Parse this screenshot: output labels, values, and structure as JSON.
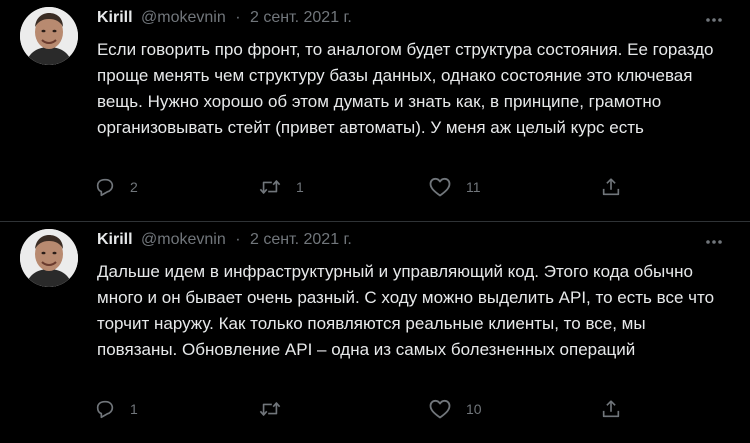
{
  "tweets": [
    {
      "author": "Kirill",
      "handle": "@mokevnin",
      "separator": "·",
      "date": "2 сент. 2021 г.",
      "text": "Если говорить про фронт, то аналогом будет структура состояния. Ее гораздо проще менять чем структуру базы данных, однако состояние это ключевая вещь. Нужно хорошо об этом думать и знать как, в принципе, грамотно организовывать стейт (привет автоматы). У меня аж целый курс есть",
      "reply_count": "2",
      "retweet_count": "1",
      "like_count": "11"
    },
    {
      "author": "Kirill",
      "handle": "@mokevnin",
      "separator": "·",
      "date": "2 сент. 2021 г.",
      "text": "Дальше идем в инфраструктурный и управляющий код. Этого кода обычно много и он бывает очень разный. С ходу можно выделить API, то есть все что торчит наружу. Как только появляются реальные клиенты, то все, мы повязаны. Обновление API – одна из самых болезненных операций",
      "reply_count": "1",
      "retweet_count": "",
      "like_count": "10"
    }
  ],
  "icons": {
    "reply": "reply-icon",
    "retweet": "retweet-icon",
    "like": "heart-icon",
    "share": "share-icon",
    "more": "more-icon"
  },
  "colors": {
    "background": "#000000",
    "text": "#e7e9ea",
    "secondary": "#71767b",
    "divider": "#2f3336"
  }
}
